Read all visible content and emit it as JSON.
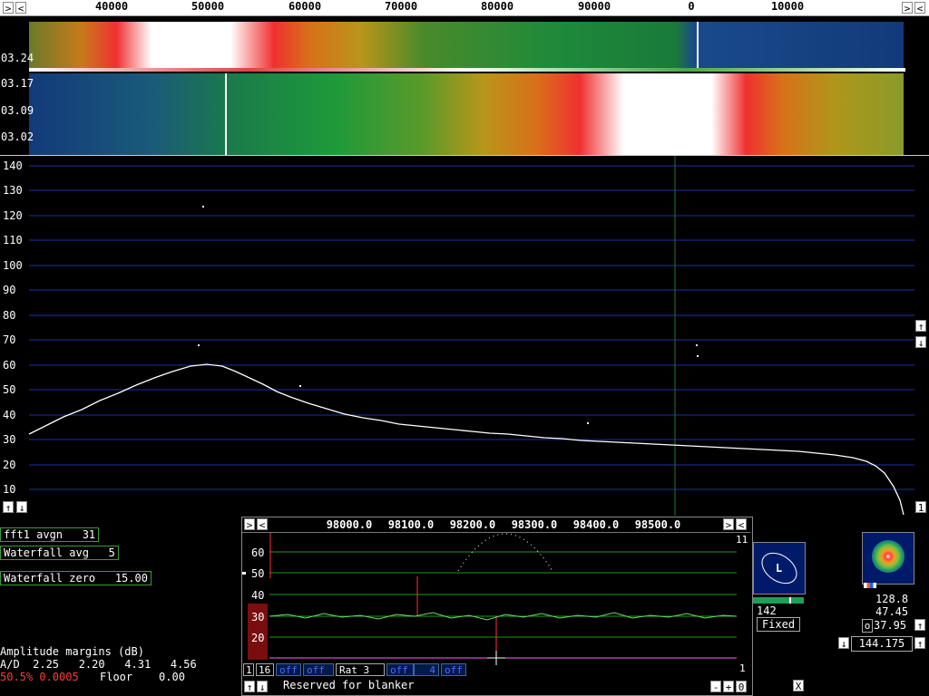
{
  "top_axis": {
    "labels": [
      "40000",
      "50000",
      "60000",
      "70000",
      "80000",
      "90000",
      "0",
      "10000"
    ]
  },
  "waterfall": {
    "time_labels": [
      "03.24",
      "03.17",
      "03.09",
      "03.02"
    ]
  },
  "spectrum": {
    "y_labels": [
      "140",
      "130",
      "120",
      "110",
      "100",
      "90",
      "80",
      "70",
      "60",
      "50",
      "40",
      "30",
      "20",
      "10"
    ],
    "right_indicator": "1"
  },
  "params": {
    "fft1_avgn": "fft1 avgn   31",
    "waterfall_avg": "Waterfall avg   5",
    "waterfall_zero": "Waterfall zero   15.00"
  },
  "amplitude": {
    "title": "Amplitude margins (dB)",
    "ad_line": "A/D  2.25   2.20   4.31   4.56",
    "percent": "50.5% 0.0005",
    "floor": "Floor    0.00"
  },
  "subwindow": {
    "freq_labels": [
      "98000.0",
      "98100.0",
      "98200.0",
      "98300.0",
      "98400.0",
      "98500.0"
    ],
    "top_right": "11",
    "y_labels": [
      "60",
      "50",
      "40",
      "30",
      "20"
    ],
    "bottom_right": "1",
    "bottom_bar": {
      "b1": "1",
      "b16": "16",
      "off1": "off",
      "off2": "off",
      "rat": "Rat   3",
      "off3": "off",
      "off4": "4",
      "off5": "off"
    },
    "footer": "Reserved for blanker"
  },
  "polar": {
    "letter": "L",
    "value": "142",
    "mode": "Fixed"
  },
  "meter": {
    "v1": "128.8",
    "v2": "47.45",
    "o_label": "o",
    "v3": "37.95",
    "freq": "144.175"
  },
  "close_label": "X",
  "colors": {
    "grid_blue": "#1c2fa8",
    "grid_green": "#1d9a1d",
    "trace_white": "#ffffff",
    "marker_green": "#1f7a1f"
  }
}
